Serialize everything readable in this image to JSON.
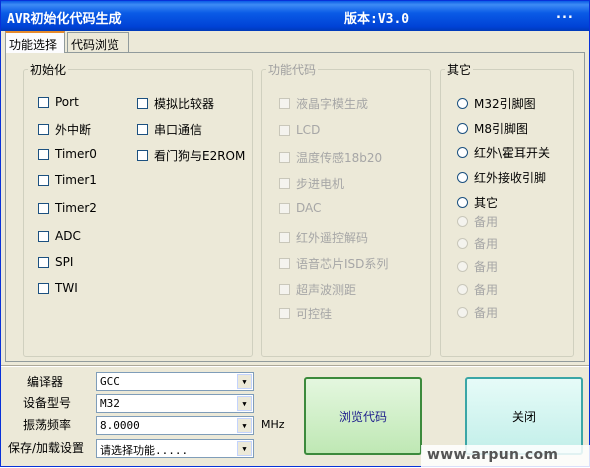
{
  "window": {
    "title": "AVR初始化代码生成",
    "version": "版本:V3.0",
    "menu_dots": "..."
  },
  "tabs": [
    {
      "label": "功能选择",
      "active": true
    },
    {
      "label": "代码浏览",
      "active": false
    }
  ],
  "init_group": {
    "legend": "初始化",
    "items": [
      {
        "label": "Port",
        "checked": false
      },
      {
        "label": "外中断",
        "checked": false
      },
      {
        "label": "Timer0",
        "checked": false
      },
      {
        "label": "Timer1",
        "checked": false
      },
      {
        "label": "Timer2",
        "checked": false
      },
      {
        "label": "ADC",
        "checked": false
      },
      {
        "label": "SPI",
        "checked": false
      },
      {
        "label": "TWI",
        "checked": false
      },
      {
        "label": "模拟比较器",
        "checked": false
      },
      {
        "label": "串口通信",
        "checked": false
      },
      {
        "label": "看门狗与E2ROM",
        "checked": false
      }
    ]
  },
  "func_group": {
    "legend": "功能代码",
    "items": [
      {
        "label": "液晶字模生成"
      },
      {
        "label": "LCD"
      },
      {
        "label": "温度传感18b20"
      },
      {
        "label": "步进电机"
      },
      {
        "label": "DAC"
      },
      {
        "label": "红外遥控解码"
      },
      {
        "label": "语音芯片ISD系列"
      },
      {
        "label": "超声波测距"
      },
      {
        "label": "可控硅"
      }
    ]
  },
  "other_group": {
    "legend": "其它",
    "items": [
      {
        "label": "M32引脚图",
        "enabled": true
      },
      {
        "label": "M8引脚图",
        "enabled": true
      },
      {
        "label": "红外\\霍耳开关",
        "enabled": true
      },
      {
        "label": "红外接收引脚",
        "enabled": true
      },
      {
        "label": "其它",
        "enabled": true
      },
      {
        "label": "备用",
        "enabled": false
      },
      {
        "label": "备用",
        "enabled": false
      },
      {
        "label": "备用",
        "enabled": false
      },
      {
        "label": "备用",
        "enabled": false
      },
      {
        "label": "备用",
        "enabled": false
      }
    ]
  },
  "settings": {
    "compiler_label": "编译器",
    "compiler_value": "GCC",
    "device_label": "设备型号",
    "device_value": "M32",
    "freq_label": "振荡频率",
    "freq_value": "8.0000",
    "freq_unit": "MHz",
    "save_label": "保存/加载设置",
    "save_value": "请选择功能....."
  },
  "buttons": {
    "browse": "浏览代码",
    "close": "关闭"
  },
  "watermark": "www.arpun.com"
}
